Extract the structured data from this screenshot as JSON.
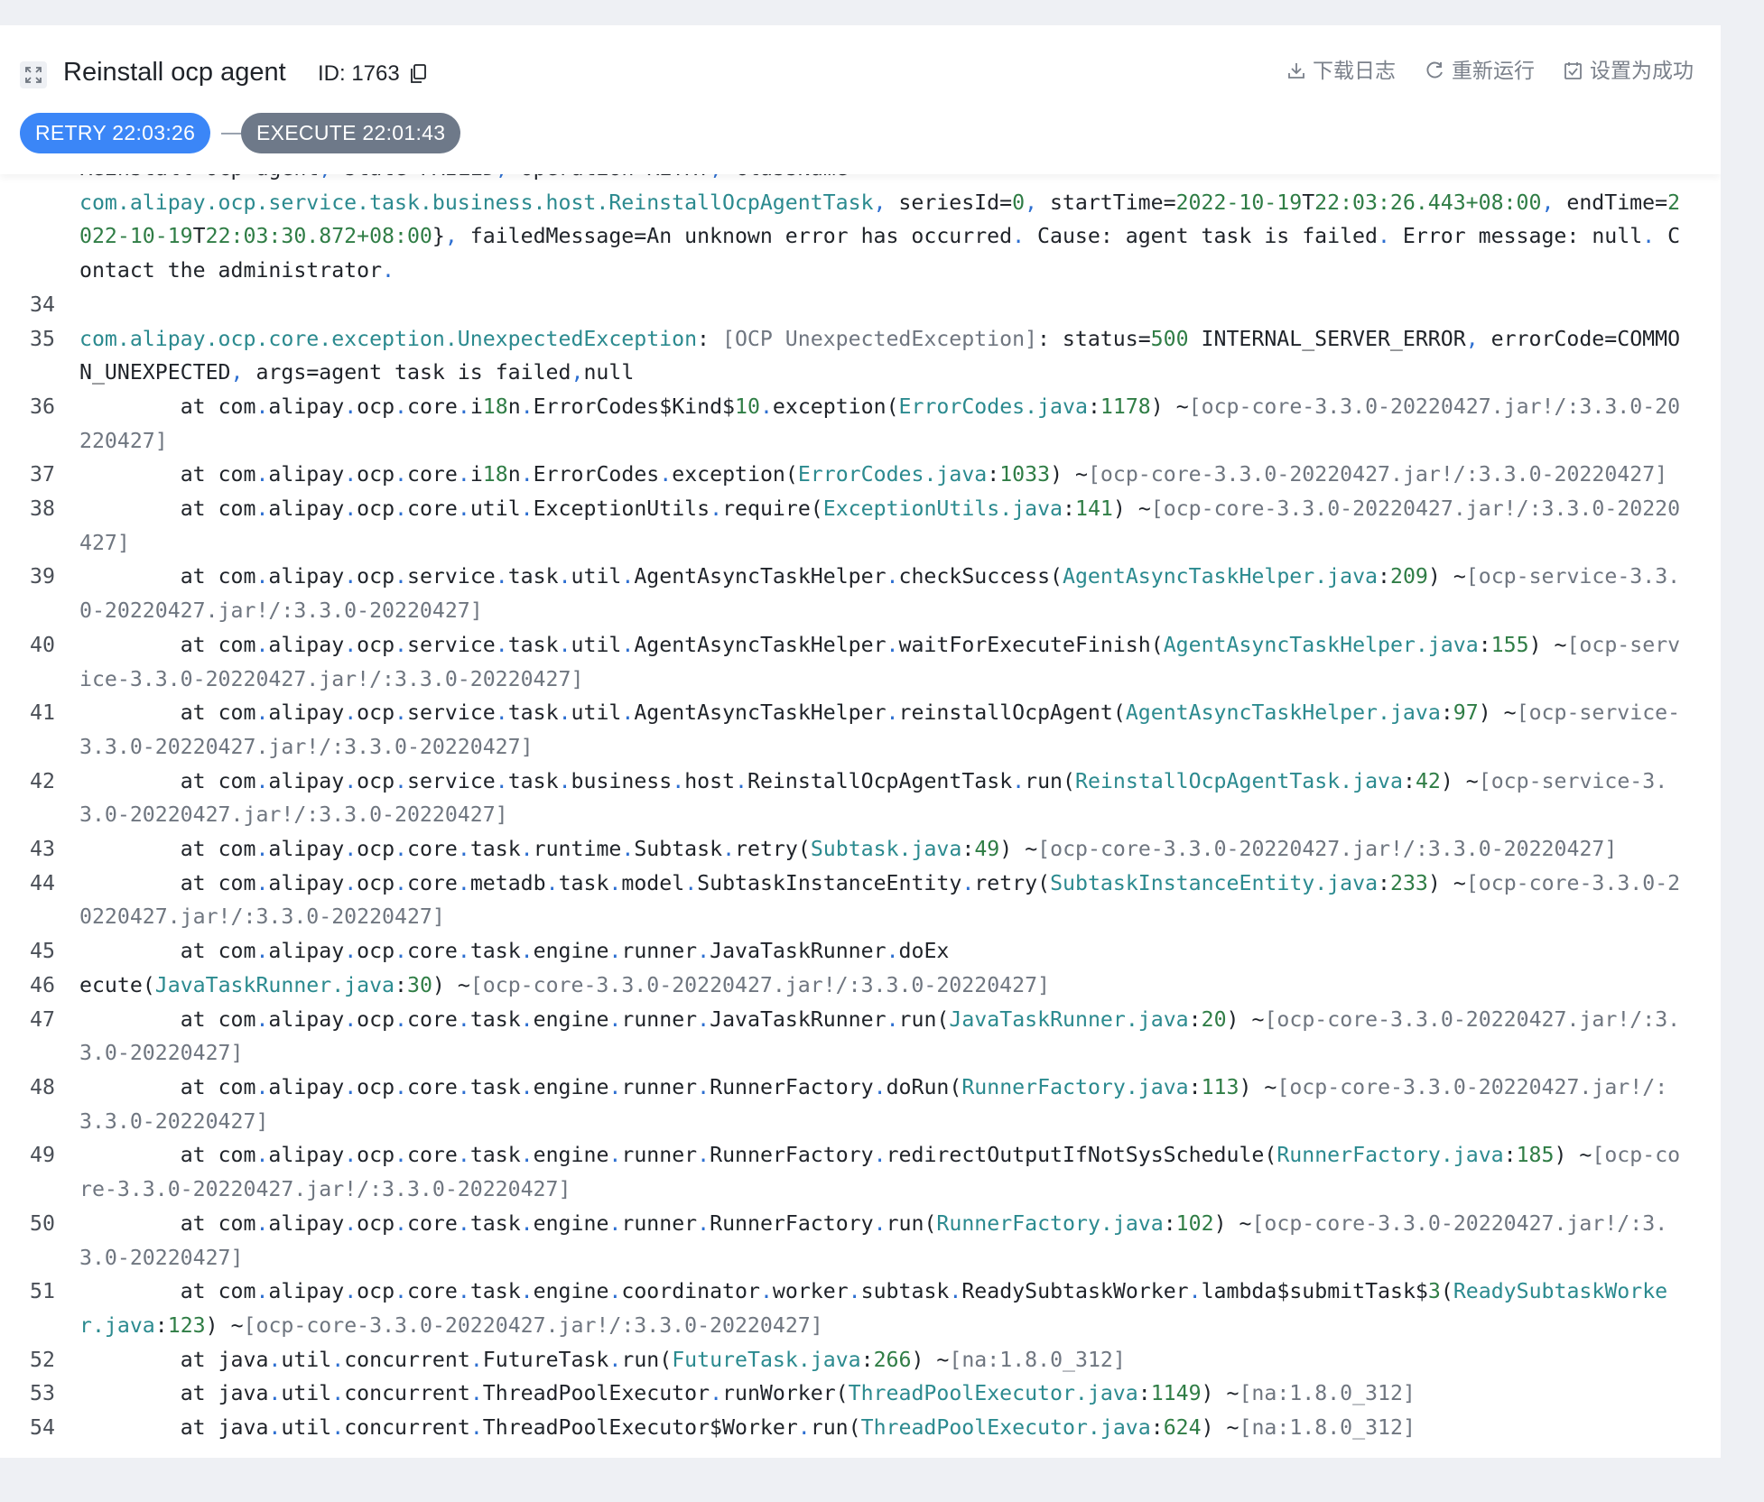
{
  "header": {
    "title": "Reinstall ocp agent",
    "id_label": "ID: 1763",
    "actions": {
      "download": "下载日志",
      "rerun": "重新运行",
      "set_success": "设置为成功"
    },
    "executions": [
      {
        "label": "RETRY 22:03:26",
        "state": "active"
      },
      {
        "label": "EXECUTE 22:01:43",
        "state": "inactive"
      }
    ]
  },
  "log": {
    "lines": [
      {
        "num": "",
        "text": "Reinstall ocp agent, state=FAILED, operation=RETRY, className="
      },
      {
        "num": "",
        "text": "com.alipay.ocp.service.task.business.host.ReinstallOcpAgentTask, seriesId=0, startTime=2022-10-19T22:03:26.443+08:00, endTime=2022-10-19T22:03:30.872+08:00}, failedMessage=An unknown error has occurred. Cause: agent task is failed. Error message: null. Contact the administrator."
      },
      {
        "num": "34",
        "text": ""
      },
      {
        "num": "35",
        "text": "com.alipay.ocp.core.exception.UnexpectedException: [OCP UnexpectedException]: status=500 INTERNAL_SERVER_ERROR, errorCode=COMMON_UNEXPECTED, args=agent task is failed,null"
      },
      {
        "num": "36",
        "text": "        at com.alipay.ocp.core.i18n.ErrorCodes$Kind$10.exception(ErrorCodes.java:1178) ~[ocp-core-3.3.0-20220427.jar!/:3.3.0-20220427]"
      },
      {
        "num": "37",
        "text": "        at com.alipay.ocp.core.i18n.ErrorCodes.exception(ErrorCodes.java:1033) ~[ocp-core-3.3.0-20220427.jar!/:3.3.0-20220427]"
      },
      {
        "num": "38",
        "text": "        at com.alipay.ocp.core.util.ExceptionUtils.require(ExceptionUtils.java:141) ~[ocp-core-3.3.0-20220427.jar!/:3.3.0-20220427]"
      },
      {
        "num": "39",
        "text": "        at com.alipay.ocp.service.task.util.AgentAsyncTaskHelper.checkSuccess(AgentAsyncTaskHelper.java:209) ~[ocp-service-3.3.0-20220427.jar!/:3.3.0-20220427]"
      },
      {
        "num": "40",
        "text": "        at com.alipay.ocp.service.task.util.AgentAsyncTaskHelper.waitForExecuteFinish(AgentAsyncTaskHelper.java:155) ~[ocp-service-3.3.0-20220427.jar!/:3.3.0-20220427]"
      },
      {
        "num": "41",
        "text": "        at com.alipay.ocp.service.task.util.AgentAsyncTaskHelper.reinstallOcpAgent(AgentAsyncTaskHelper.java:97) ~[ocp-service-3.3.0-20220427.jar!/:3.3.0-20220427]"
      },
      {
        "num": "42",
        "text": "        at com.alipay.ocp.service.task.business.host.ReinstallOcpAgentTask.run(ReinstallOcpAgentTask.java:42) ~[ocp-service-3.3.0-20220427.jar!/:3.3.0-20220427]"
      },
      {
        "num": "43",
        "text": "        at com.alipay.ocp.core.task.runtime.Subtask.retry(Subtask.java:49) ~[ocp-core-3.3.0-20220427.jar!/:3.3.0-20220427]"
      },
      {
        "num": "44",
        "text": "        at com.alipay.ocp.core.metadb.task.model.SubtaskInstanceEntity.retry(SubtaskInstanceEntity.java:233) ~[ocp-core-3.3.0-20220427.jar!/:3.3.0-20220427]"
      },
      {
        "num": "45",
        "text": "        at com.alipay.ocp.core.task.engine.runner.JavaTaskRunner.doEx"
      },
      {
        "num": "46",
        "text": "ecute(JavaTaskRunner.java:30) ~[ocp-core-3.3.0-20220427.jar!/:3.3.0-20220427]"
      },
      {
        "num": "47",
        "text": "        at com.alipay.ocp.core.task.engine.runner.JavaTaskRunner.run(JavaTaskRunner.java:20) ~[ocp-core-3.3.0-20220427.jar!/:3.3.0-20220427]"
      },
      {
        "num": "48",
        "text": "        at com.alipay.ocp.core.task.engine.runner.RunnerFactory.doRun(RunnerFactory.java:113) ~[ocp-core-3.3.0-20220427.jar!/:3.3.0-20220427]"
      },
      {
        "num": "49",
        "text": "        at com.alipay.ocp.core.task.engine.runner.RunnerFactory.redirectOutputIfNotSysSchedule(RunnerFactory.java:185) ~[ocp-core-3.3.0-20220427.jar!/:3.3.0-20220427]"
      },
      {
        "num": "50",
        "text": "        at com.alipay.ocp.core.task.engine.runner.RunnerFactory.run(RunnerFactory.java:102) ~[ocp-core-3.3.0-20220427.jar!/:3.3.0-20220427]"
      },
      {
        "num": "51",
        "text": "        at com.alipay.ocp.core.task.engine.coordinator.worker.subtask.ReadySubtaskWorker.lambda$submitTask$3(ReadySubtaskWorker.java:123) ~[ocp-core-3.3.0-20220427.jar!/:3.3.0-20220427]"
      },
      {
        "num": "52",
        "text": "        at java.util.concurrent.FutureTask.run(FutureTask.java:266) ~[na:1.8.0_312]"
      },
      {
        "num": "53",
        "text": "        at java.util.concurrent.ThreadPoolExecutor.runWorker(ThreadPoolExecutor.java:1149) ~[na:1.8.0_312]"
      },
      {
        "num": "54",
        "text": "        at java.util.concurrent.ThreadPoolExecutor$Worker.run(ThreadPoolExecutor.java:624) ~[na:1.8.0_312]"
      }
    ]
  },
  "colors": {
    "retry_pill": "#3b86f7",
    "execute_pill": "#6e7989",
    "package_text": "#2b8a8f",
    "number_text": "#2f7d45",
    "bracket_text": "#6f7680"
  }
}
